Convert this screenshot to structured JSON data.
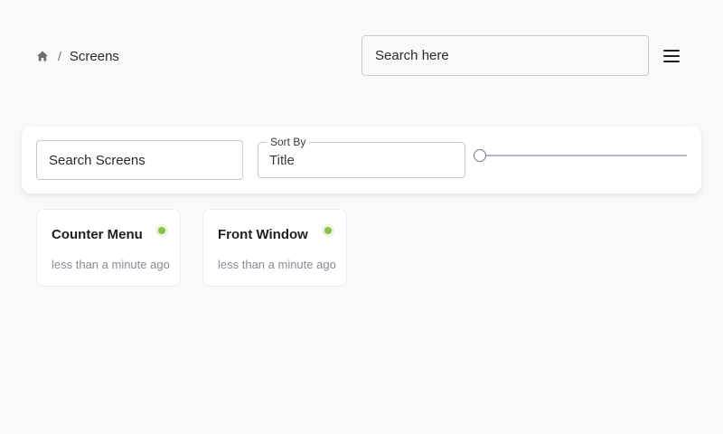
{
  "breadcrumb": {
    "home_icon": "home-icon",
    "separator": "/",
    "current": "Screens"
  },
  "header": {
    "search_placeholder": "Search here",
    "menu_icon": "hamburger-menu-icon"
  },
  "filters": {
    "search_placeholder": "Search Screens",
    "sort_label": "Sort By",
    "sort_value": "Title",
    "slider_value": 0
  },
  "screens": [
    {
      "title": "Counter Menu",
      "updated": "less than a minute ago",
      "status_color": "#8bc34a"
    },
    {
      "title": "Front Window",
      "updated": "less than a minute ago",
      "status_color": "#8bc34a"
    }
  ]
}
